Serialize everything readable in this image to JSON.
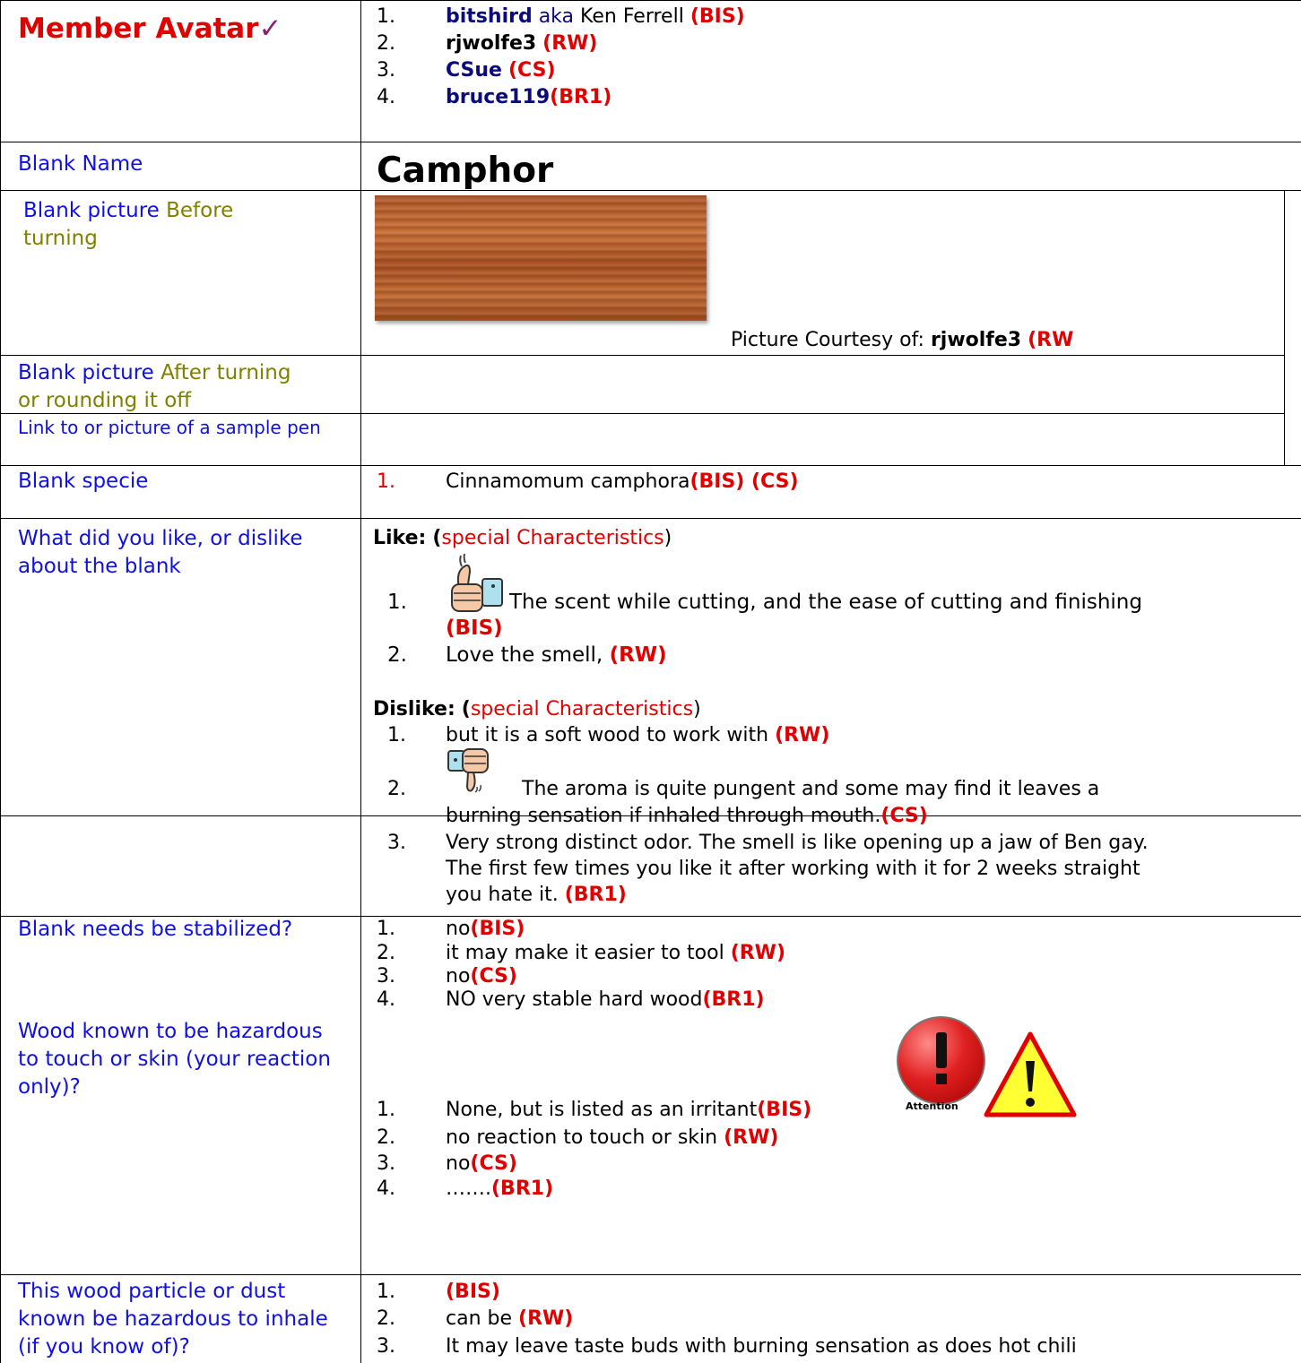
{
  "title": {
    "text": "Member Avatar",
    "check": "✓"
  },
  "members": [
    {
      "num": "1.",
      "name": "bitshird",
      "aka": "aka",
      "real": "Ken Ferrell",
      "tag": "(BIS)"
    },
    {
      "num": "2.",
      "name": "rjwolfe3",
      "tag": "(RW)"
    },
    {
      "num": "3.",
      "name": "CSue",
      "tag": "(CS)"
    },
    {
      "num": "4.",
      "name": "bruce119",
      "tag": "(BR1)"
    }
  ],
  "labels": {
    "blank_name": "Blank Name",
    "before_a": "Blank picture",
    "before_b": "Before",
    "before_c": "turning",
    "after_a": "Blank picture",
    "after_b": "After turning",
    "after_c": "or rounding it off",
    "sample_pen": "Link to or picture of a sample pen",
    "specie": "Blank specie",
    "like_dislike": "What did you like, or dislike about the blank",
    "stabilized": "Blank needs be stabilized?",
    "hazard_touch": "Wood known to be hazardous to touch or skin (your reaction only)?",
    "hazard_inhale": "This wood particle or dust known be hazardous to inhale (if you know of)?"
  },
  "blank_name_value": "Camphor",
  "picture_courtesy": {
    "prefix": "Picture Courtesy of:",
    "name": "rjwolfe3",
    "tag": "(RW"
  },
  "specie": {
    "num": "1.",
    "text": "Cinnamomum camphora",
    "tags": "(BIS) (CS)"
  },
  "like": {
    "heading": "Like:",
    "open": "(",
    "special": "special Characteristics",
    "close": ")",
    "items": [
      {
        "num": "1.",
        "text": "The scent while cutting, and the ease of cutting and finishing",
        "tag": "(BIS)"
      },
      {
        "num": "2.",
        "text": "Love the smell,",
        "tag": "(RW)"
      }
    ]
  },
  "dislike": {
    "heading": "Dislike:",
    "open": "(",
    "special": "special Characteristics",
    "close": ")",
    "items": [
      {
        "num": "1.",
        "text": "but it is a soft wood to work with",
        "tag": "(RW)"
      },
      {
        "num": "2.",
        "line1": "The aroma is quite pungent and some may find it leaves a",
        "line2": "burning sensation if inhaled through mouth.",
        "tag": "(CS)"
      },
      {
        "num": "3.",
        "line1": "Very strong distinct odor. The smell is like opening up a jaw of Ben gay.",
        "line2": "The first few times you like it after working with it for 2 weeks straight",
        "line3": "you hate it.",
        "tag": "(BR1)"
      }
    ]
  },
  "stabilized": [
    {
      "num": "1.",
      "text": "no",
      "tag": "(BIS)"
    },
    {
      "num": "2.",
      "text": "it may make it easier to tool ",
      "tag": "(RW)"
    },
    {
      "num": "3.",
      "text": "no",
      "tag": "(CS)"
    },
    {
      "num": "4.",
      "text": "NO very stable hard wood",
      "tag": "(BR1)"
    }
  ],
  "hazard_touch": [
    {
      "num": "1.",
      "text": "None, but is listed as an irritant",
      "tag": "(BIS)"
    },
    {
      "num": "2.",
      "text": "no reaction to touch or skin ",
      "tag": "(RW)"
    },
    {
      "num": "3.",
      "text": "no",
      "tag": "(CS)"
    },
    {
      "num": "4.",
      "text": "…….",
      "tag": "(BR1)"
    }
  ],
  "attention_label": "Attention",
  "hazard_inhale": [
    {
      "num": "1.",
      "text": "",
      "tag": "(BIS)"
    },
    {
      "num": "2.",
      "text": "can be ",
      "tag": "(RW)"
    },
    {
      "num": "3.",
      "text": "It may leave taste buds with burning sensation as does hot chili",
      "tag": ""
    }
  ],
  "icons": {
    "thumbs_up": "thumbs-up-icon",
    "thumbs_down": "thumbs-down-icon",
    "attention": "attention-icon",
    "warning": "warning-triangle-icon"
  }
}
